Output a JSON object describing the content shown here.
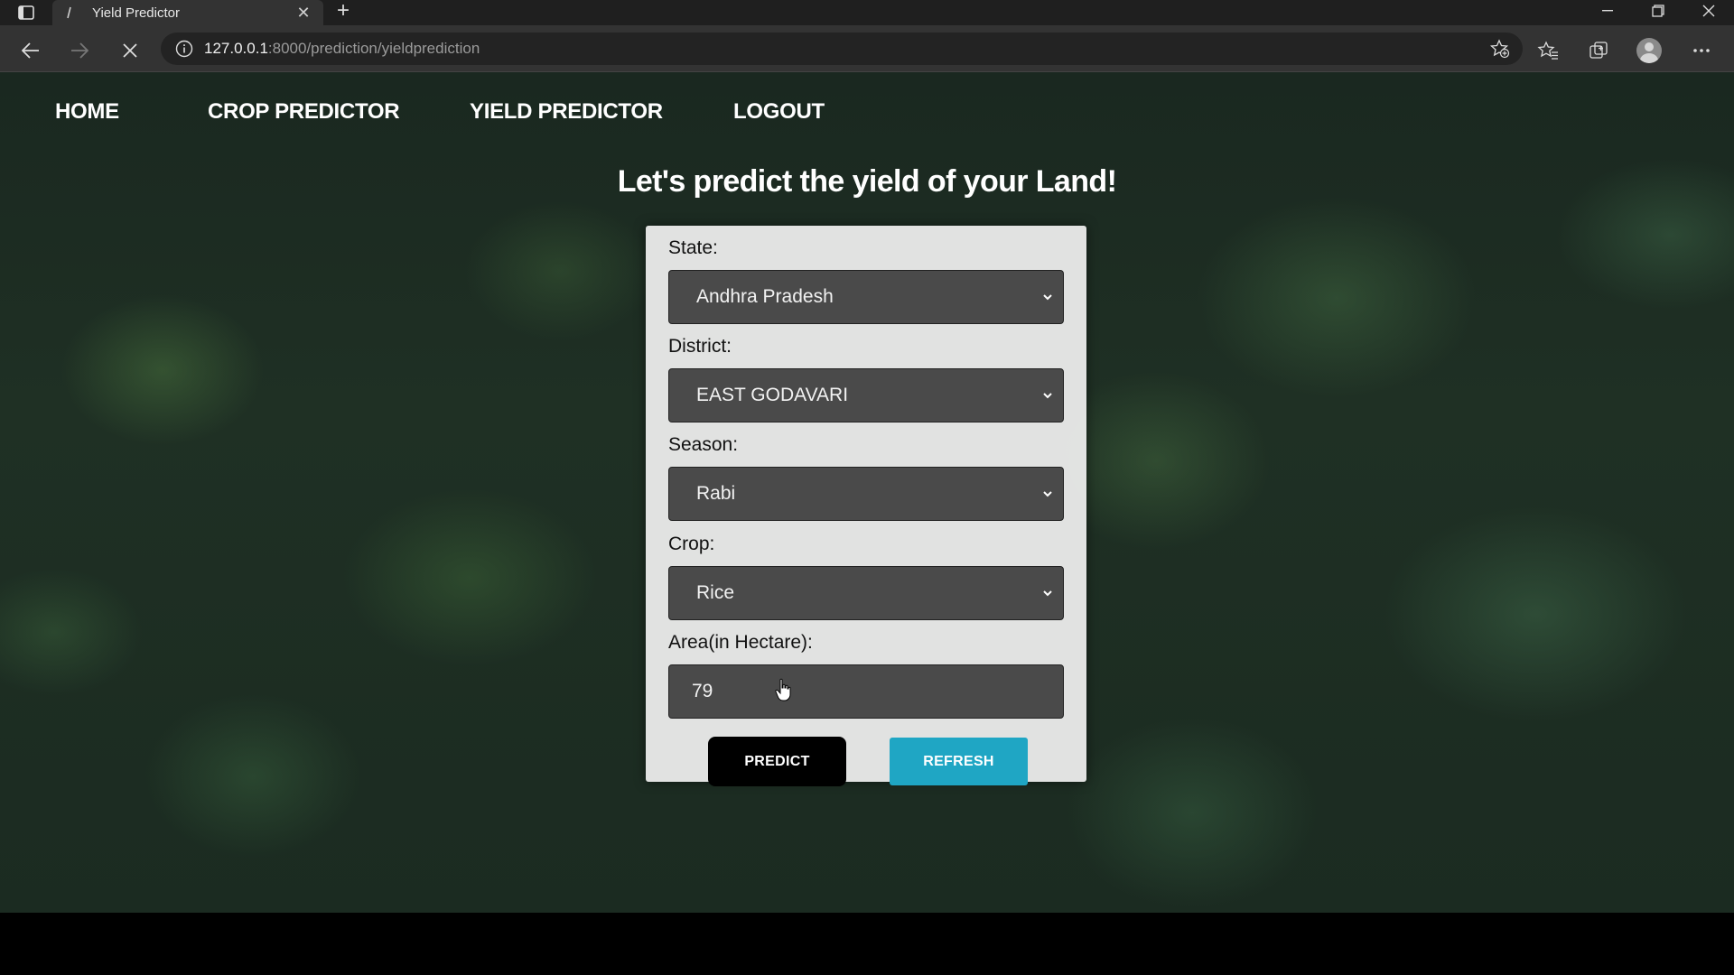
{
  "browser": {
    "tab_title": "Yield Predictor",
    "new_tab_label": "+",
    "url_host": "127.0.0.1",
    "url_path": ":8000/prediction/yieldprediction"
  },
  "nav": {
    "home": "HOME",
    "crop_predictor": "CROP PREDICTOR",
    "yield_predictor": "YIELD PREDICTOR",
    "logout": "LOGOUT"
  },
  "heading": "Let's predict the yield of your Land!",
  "form": {
    "state_label": "State:",
    "state_value": "Andhra Pradesh",
    "district_label": "District:",
    "district_value": "EAST GODAVARI",
    "season_label": "Season:",
    "season_value": "Rabi",
    "crop_label": "Crop:",
    "crop_value": "Rice",
    "area_label": "Area(in Hectare):",
    "area_value": "79",
    "predict_label": "PREDICT",
    "refresh_label": "REFRESH"
  },
  "colors": {
    "refresh_button": "#1fa6c4",
    "predict_button": "#000000",
    "card_background": "#f0f0f0"
  },
  "icons": [
    "sidebar-toggle-icon",
    "favicon-icon",
    "tab-close-icon",
    "back-icon",
    "forward-icon",
    "stop-icon",
    "info-icon",
    "add-favorite-icon",
    "favorites-icon",
    "collections-icon",
    "profile-icon",
    "more-icon",
    "chevron-down-icon",
    "cursor-icon"
  ]
}
